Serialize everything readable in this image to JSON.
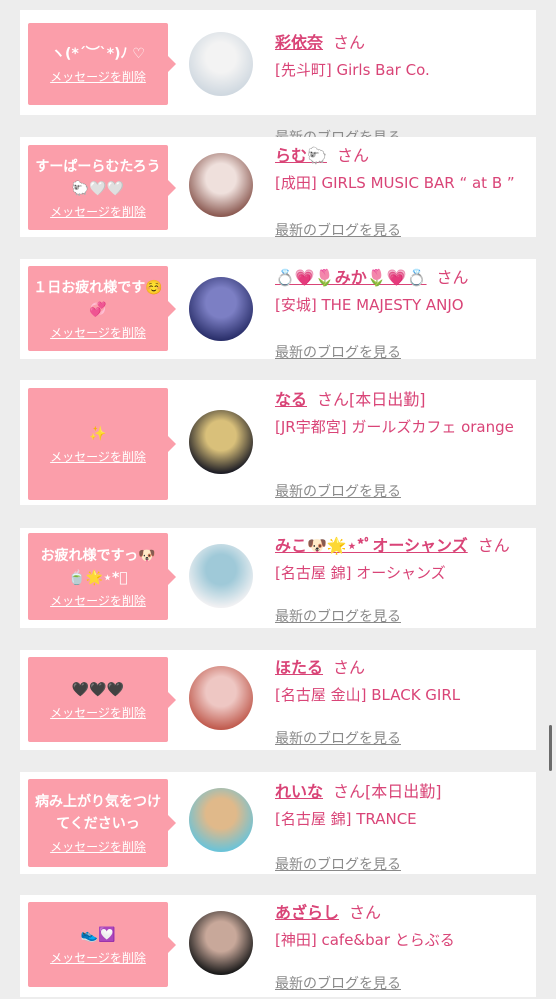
{
  "delete_label": "メッセージを削除",
  "blog_label": "最新のブログを見る",
  "honorific": "さん",
  "items": [
    {
      "message": "ヽ(*´︶`*)ﾉ ♡",
      "name": "彩依奈",
      "status": "",
      "shop": "[先斗町] Girls Bar Co.",
      "avatar_colors": [
        "#cfd8e0",
        "#f3f3f3"
      ]
    },
    {
      "message": "すーぱーらむたろう🐑🤍🤍",
      "name": "らむ🐑",
      "status": "",
      "shop": "[成田] GIRLS MUSIC BAR “ at B ”",
      "avatar_colors": [
        "#8b5a52",
        "#efe0dc"
      ]
    },
    {
      "message": "１日お疲れ様です☺️💞",
      "name": "💍💗🌷みか🌷💗💍",
      "status": "",
      "shop": "[安城] THE MAJESTY ANJO",
      "avatar_colors": [
        "#2a2f6a",
        "#7c7fc4"
      ]
    },
    {
      "message": "✨",
      "name": "なる",
      "status": "[本日出勤]",
      "shop": "[JR宇都宮] ガールズカフェ orange",
      "avatar_colors": [
        "#1d1d25",
        "#d9c07a"
      ]
    },
    {
      "message": "お疲れ様ですっ🐶🍵🌟⋆*ﾟ",
      "name": "みこ🐶🌟⋆*ﾟオーシャンズ",
      "status": "",
      "shop": "[名古屋 錦] オーシャンズ",
      "avatar_colors": [
        "#f1f1f3",
        "#9fc9d8"
      ]
    },
    {
      "message": "🖤🖤🖤",
      "name": "ほたる",
      "status": "",
      "shop": "[名古屋 金山] BLACK GIRL",
      "avatar_colors": [
        "#c05b4e",
        "#eec7c3"
      ]
    },
    {
      "message": "病み上がり気をつけてくださいっ",
      "name": "れいな",
      "status": "[本日出勤]",
      "shop": "[名古屋 錦] TRANCE",
      "avatar_colors": [
        "#6bc3d8",
        "#e0b98a"
      ]
    },
    {
      "message": "👟💟",
      "name": "あざらし",
      "status": "",
      "shop": "[神田] cafe&bar とらぶる",
      "avatar_colors": [
        "#1a1a1a",
        "#c8a89a"
      ]
    }
  ]
}
